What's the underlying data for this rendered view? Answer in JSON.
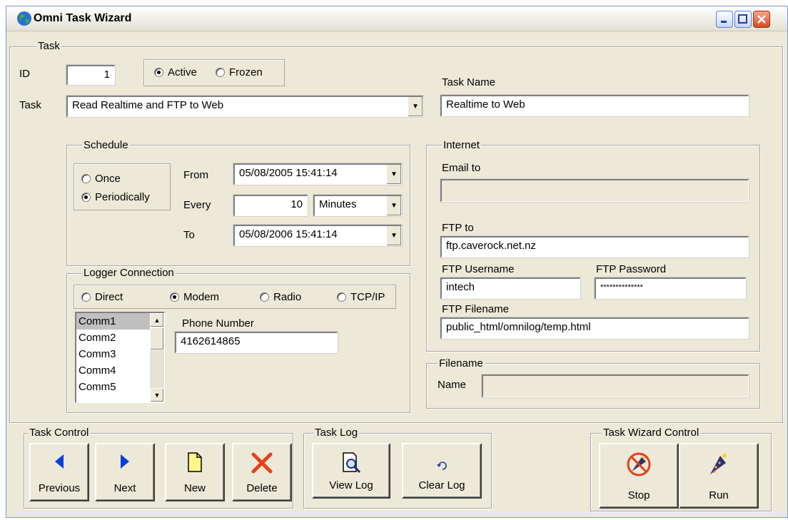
{
  "window": {
    "title": "Omni Task Wizard"
  },
  "task": {
    "group_label": "Task",
    "id_label": "ID",
    "id_value": "1",
    "status_options": [
      "Active",
      "Frozen"
    ],
    "status_selected": "Active",
    "task_label": "Task",
    "task_value": "Read Realtime and FTP to Web",
    "task_name_label": "Task Name",
    "task_name_value": "Realtime to Web"
  },
  "schedule": {
    "group_label": "Schedule",
    "modes": [
      "Once",
      "Periodically"
    ],
    "mode_selected": "Periodically",
    "from_label": "From",
    "from_value": "05/08/2005 15:41:14",
    "every_label": "Every",
    "every_value": "10",
    "every_unit": "Minutes",
    "to_label": "To",
    "to_value": "05/08/2006 15:41:14"
  },
  "logger": {
    "group_label": "Logger Connection",
    "connection_types": [
      "Direct",
      "Modem",
      "Radio",
      "TCP/IP"
    ],
    "connection_selected": "Modem",
    "ports": [
      "Comm1",
      "Comm2",
      "Comm3",
      "Comm4",
      "Comm5"
    ],
    "port_selected": "Comm1",
    "phone_label": "Phone Number",
    "phone_value": "4162614865"
  },
  "internet": {
    "group_label": "Internet",
    "email_label": "Email to",
    "email_value": "",
    "ftp_label": "FTP to",
    "ftp_value": "ftp.caverock.net.nz",
    "username_label": "FTP Username",
    "username_value": "intech",
    "password_label": "FTP Password",
    "password_value": "**************",
    "filename_label": "FTP Filename",
    "filename_value": "public_html/omnilog/temp.html"
  },
  "filename": {
    "group_label": "Filename",
    "name_label": "Name",
    "name_value": ""
  },
  "task_control": {
    "group_label": "Task Control",
    "previous": "Previous",
    "next": "Next",
    "new": "New",
    "delete": "Delete"
  },
  "task_log": {
    "group_label": "Task Log",
    "view": "View Log",
    "clear": "Clear Log"
  },
  "wizard_control": {
    "group_label": "Task Wizard Control",
    "stop": "Stop",
    "run": "Run"
  },
  "colors": {
    "dialog_bg": "#ece9d8",
    "arrow_blue": "#0a3fdc",
    "delete_red": "#e8401a",
    "new_yellow": "#fff68a"
  }
}
